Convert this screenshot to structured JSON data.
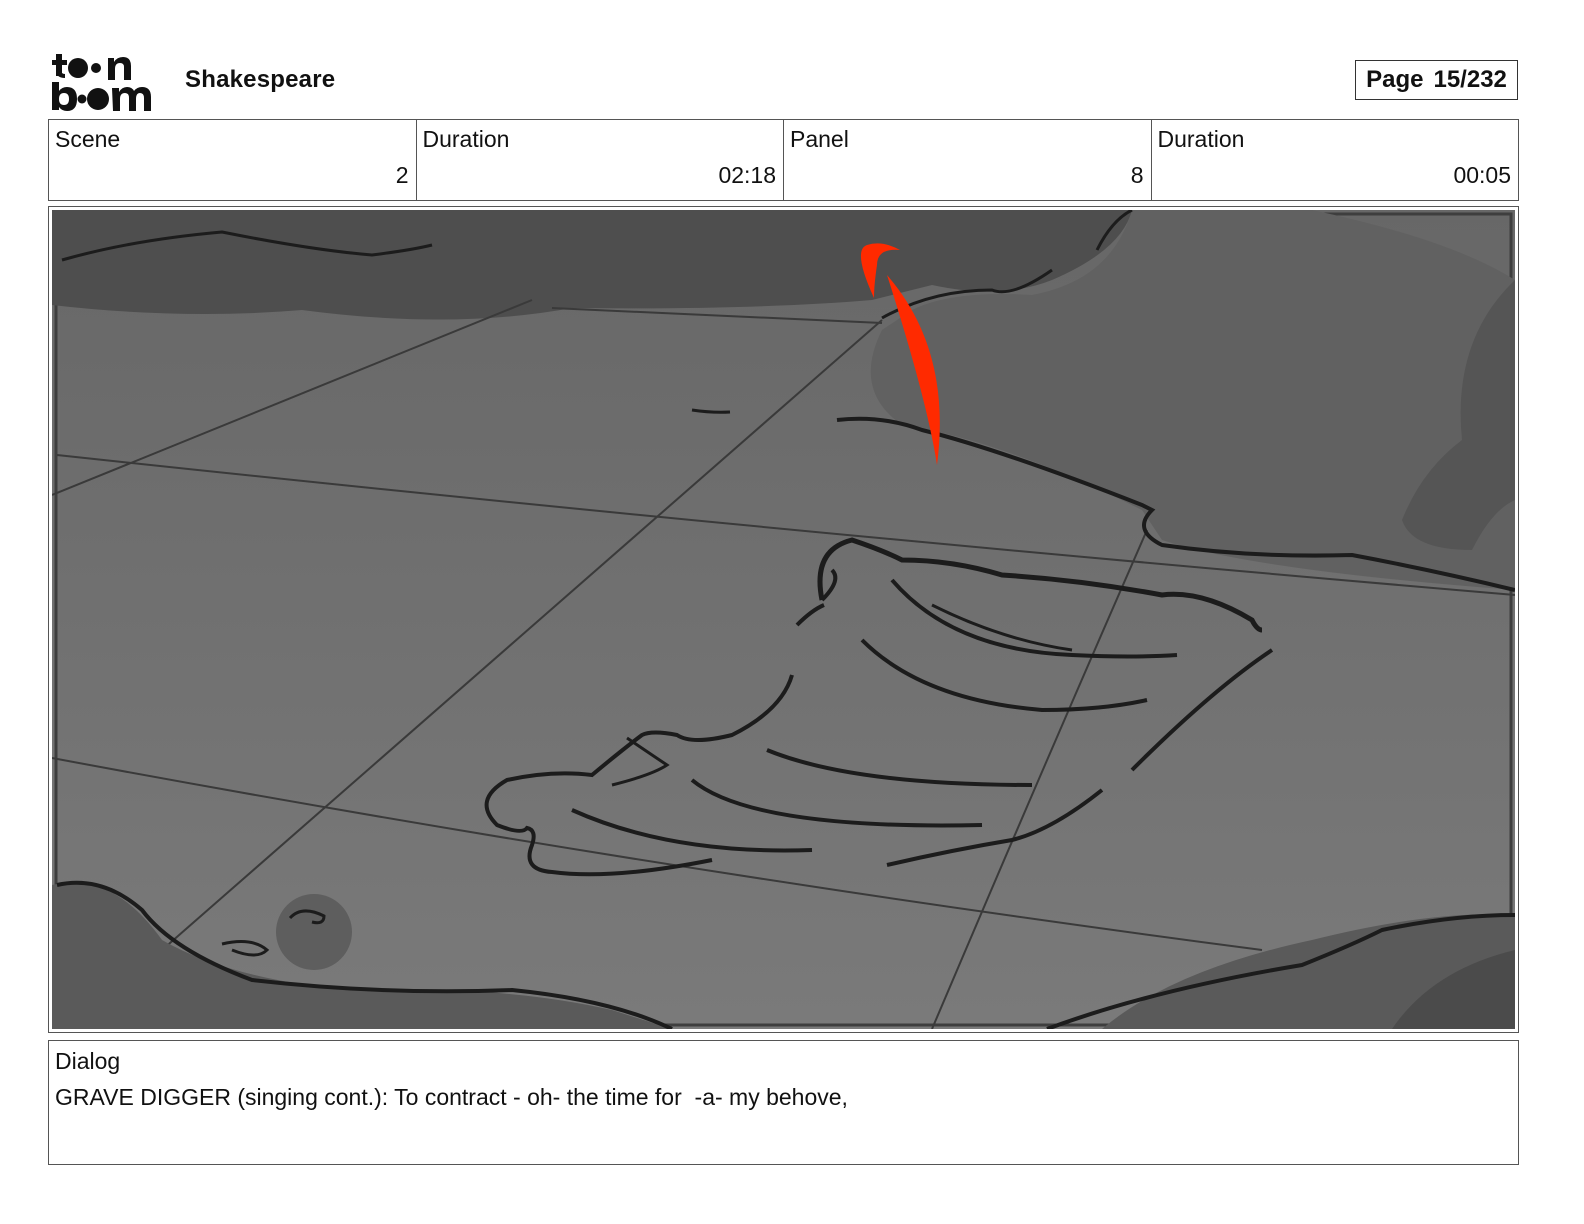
{
  "header": {
    "logo_text": "toon boom",
    "project_title": "Shakespeare",
    "page_label": "Page",
    "page_value": "15/232"
  },
  "info": {
    "scene_label": "Scene",
    "scene_value": "2",
    "scene_duration_label": "Duration",
    "scene_duration_value": "02:18",
    "panel_label": "Panel",
    "panel_value": "8",
    "panel_duration_label": "Duration",
    "panel_duration_value": "00:05"
  },
  "panel_image": {
    "description_icon": "storyboard-sketch",
    "colors": {
      "floor": "#707070",
      "shadow": "#4f4f4f",
      "line": "#262626",
      "accent": "#ff2a00"
    }
  },
  "dialog": {
    "label": "Dialog",
    "text": "GRAVE DIGGER (singing cont.): To contract - oh- the time for  -a- my behove,"
  }
}
